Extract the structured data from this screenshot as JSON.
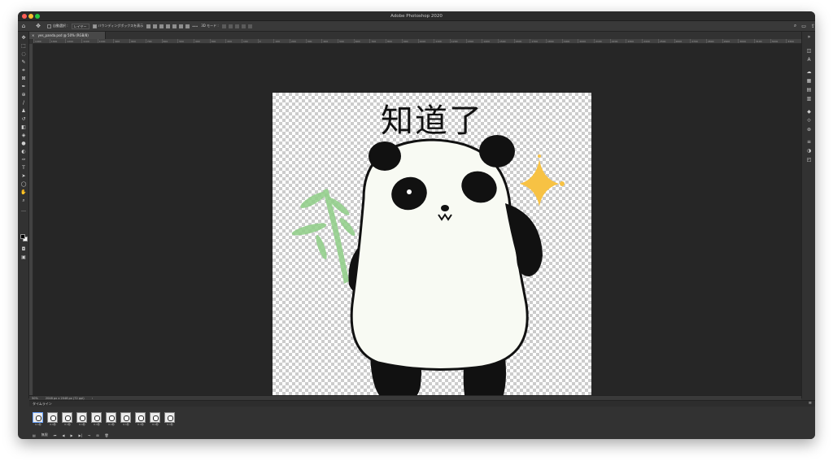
{
  "window": {
    "title": "Adobe Photoshop 2020"
  },
  "options_bar": {
    "auto_select_label": "自動選択 :",
    "auto_select_target": "レイヤー",
    "show_transform_label": "バウンディングボックスを表示",
    "more_label": "•••",
    "mode_label": "3D モード :"
  },
  "document": {
    "tab_label": "yes_panda.psd @ 50% (RGB/8)",
    "caption": "知道了",
    "zoom": "50%",
    "dimensions": "2048 px x 2048 px (72 ppi)"
  },
  "ruler": {
    "ticks": [
      "1400",
      "1300",
      "1200",
      "1100",
      "1000",
      "900",
      "800",
      "700",
      "600",
      "500",
      "400",
      "300",
      "200",
      "100",
      "0",
      "100",
      "200",
      "300",
      "400",
      "500",
      "600",
      "700",
      "800",
      "900",
      "1000",
      "1100",
      "1200",
      "1300",
      "1400",
      "1500",
      "1600",
      "1700",
      "1800",
      "1900",
      "2000",
      "2100",
      "2200",
      "2300",
      "2400",
      "2500",
      "2600",
      "2700",
      "2800",
      "2900",
      "3000",
      "3100",
      "3200",
      "3300"
    ]
  },
  "timeline": {
    "title": "タイムライン",
    "frames": [
      {
        "duration": "0.1秒"
      },
      {
        "duration": "0.1秒"
      },
      {
        "duration": "0.1秒"
      },
      {
        "duration": "0.1秒"
      },
      {
        "duration": "0.1秒"
      },
      {
        "duration": "0.1秒"
      },
      {
        "duration": "0.1秒"
      },
      {
        "duration": "0.1秒"
      },
      {
        "duration": "0.1秒"
      },
      {
        "duration": "0.1秒"
      }
    ],
    "loop_label": "無限"
  },
  "colors": {
    "foreground": "#000000",
    "background": "#ffffff",
    "sparkle": "#f7c244",
    "bamboo": "#8fce87"
  }
}
